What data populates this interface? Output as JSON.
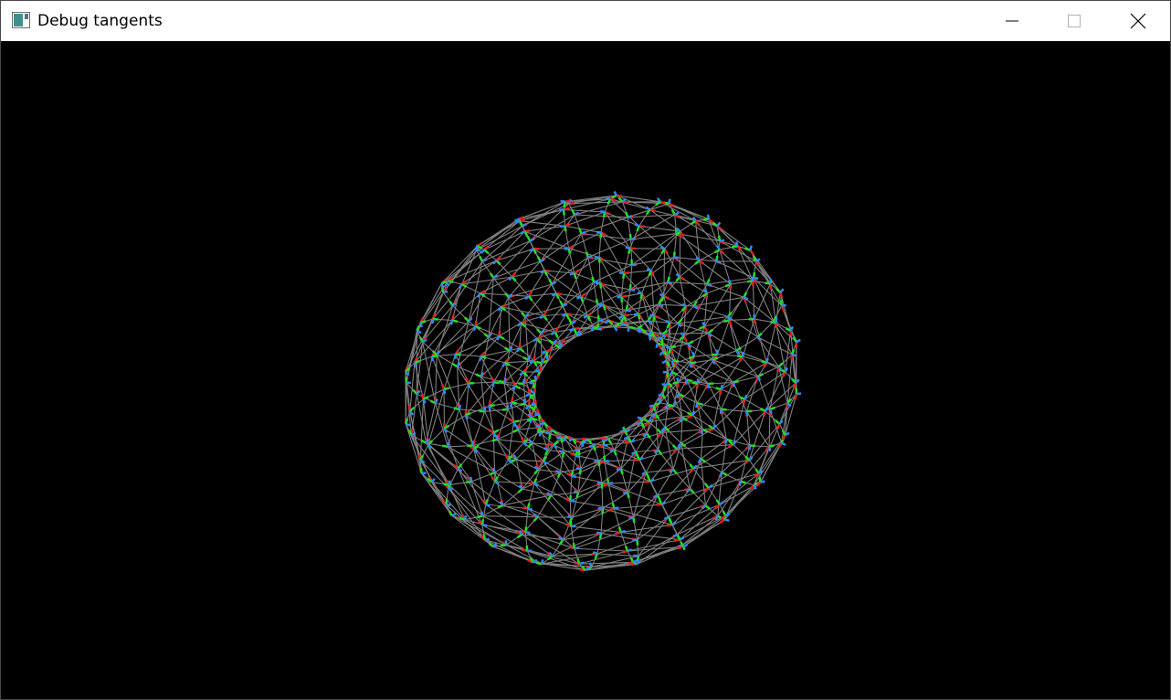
{
  "window": {
    "title": "Debug tangents",
    "icon": "app-window-icon",
    "controls": [
      {
        "name": "minimize-button",
        "icon": "minimize-icon"
      },
      {
        "name": "maximize-button",
        "icon": "maximize-icon"
      },
      {
        "name": "close-button",
        "icon": "close-icon"
      }
    ]
  },
  "scene": {
    "background": "#000000",
    "mesh": "torus",
    "wireframe_color": "#808080",
    "tangent_color": "#e02020",
    "bitangent_color": "#20e020",
    "normal_color": "#2a8cff"
  }
}
